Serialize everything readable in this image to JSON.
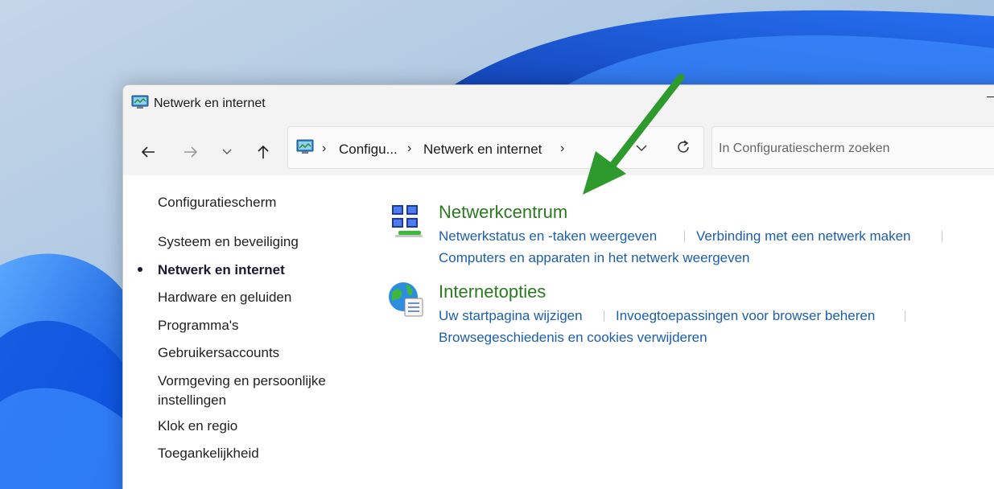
{
  "window": {
    "title": "Netwerk en internet"
  },
  "address": {
    "crumb1": "Configu...",
    "crumb2": "Netwerk en internet",
    "separator": "›"
  },
  "search": {
    "placeholder": "In Configuratiescherm zoeken"
  },
  "sidebar": {
    "home": "Configuratiescherm",
    "items": [
      {
        "label": "Systeem en beveiliging",
        "active": false
      },
      {
        "label": "Netwerk en internet",
        "active": true
      },
      {
        "label": "Hardware en geluiden",
        "active": false
      },
      {
        "label": "Programma's",
        "active": false
      },
      {
        "label": "Gebruikersaccounts",
        "active": false
      },
      {
        "label": "Vormgeving en persoonlijke",
        "active": false
      },
      {
        "label": "instellingen",
        "active": false
      },
      {
        "label": "Klok en regio",
        "active": false
      },
      {
        "label": "Toegankelijkheid",
        "active": false
      }
    ]
  },
  "categories": [
    {
      "title": "Netwerkcentrum",
      "icon": "network-center-icon",
      "links": [
        "Netwerkstatus en -taken weergeven",
        "Verbinding met een netwerk maken",
        "Computers en apparaten in het netwerk weergeven"
      ]
    },
    {
      "title": "Internetopties",
      "icon": "internet-options-icon",
      "links": [
        "Uw startpagina wijzigen",
        "Invoegtoepassingen voor browser beheren",
        "Browsegeschiedenis en cookies verwijderen"
      ]
    }
  ],
  "colors": {
    "category_title": "#2a7a1f",
    "link": "#1c5fa8",
    "annotation_arrow": "#2e9a2e"
  }
}
